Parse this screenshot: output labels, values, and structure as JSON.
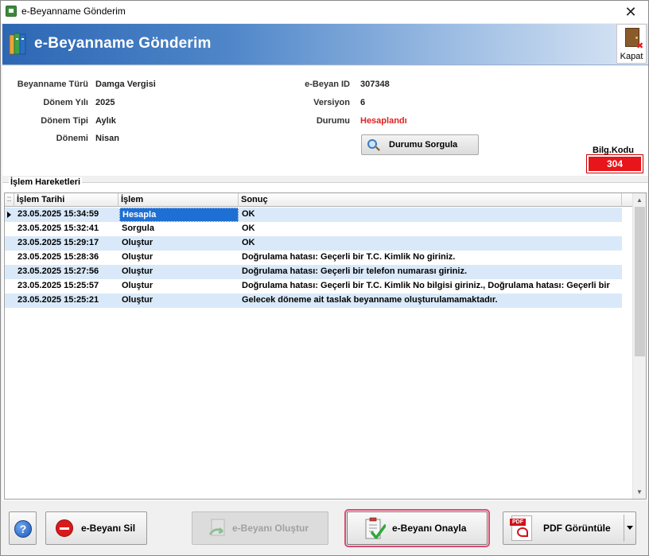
{
  "window": {
    "title": "e-Beyanname Gönderim",
    "close_glyph": "✕"
  },
  "banner": {
    "title": "e-Beyanname Gönderim",
    "icon": "books-icon",
    "close_label": "Kapat",
    "close_icon": "door-exit-icon"
  },
  "info": {
    "left": [
      {
        "label": "Beyanname Türü",
        "value": "Damga Vergisi"
      },
      {
        "label": "Dönem Yılı",
        "value": "2025"
      },
      {
        "label": "Dönem Tipi",
        "value": "Aylık"
      },
      {
        "label": "Dönemi",
        "value": "Nisan"
      }
    ],
    "right": [
      {
        "label": "e-Beyan ID",
        "value": "307348"
      },
      {
        "label": "Versiyon",
        "value": "6"
      },
      {
        "label": "Durumu",
        "value": "Hesaplandı",
        "value_color": "#e02020"
      }
    ],
    "query_button": "Durumu Sorgula",
    "bilg_kodu_label": "Bilg.Kodu",
    "bilg_kodu_value": "304",
    "bilg_kodu_color": "#e8151b"
  },
  "history": {
    "group_title": "İşlem Hareketleri",
    "indicator_header": "::",
    "columns": [
      "İşlem Tarihi",
      "İşlem",
      "Sonuç"
    ],
    "rows": [
      {
        "date": "23.05.2025 15:34:59",
        "action": "Hesapla",
        "result": "OK"
      },
      {
        "date": "23.05.2025 15:32:41",
        "action": "Sorgula",
        "result": "OK"
      },
      {
        "date": "23.05.2025 15:29:17",
        "action": "Oluştur",
        "result": "OK"
      },
      {
        "date": "23.05.2025 15:28:36",
        "action": "Oluştur",
        "result": "Doğrulama hatası: Geçerli bir T.C. Kimlik No giriniz."
      },
      {
        "date": "23.05.2025 15:27:56",
        "action": "Oluştur",
        "result": "Doğrulama hatası: Geçerli bir telefon numarası giriniz."
      },
      {
        "date": "23.05.2025 15:25:57",
        "action": "Oluştur",
        "result": "Doğrulama hatası: Geçerli bir T.C. Kimlik No bilgisi giriniz., Doğrulama hatası: Geçerli bir"
      },
      {
        "date": "23.05.2025 15:25:21",
        "action": "Oluştur",
        "result": "Gelecek döneme ait taslak beyanname oluşturulamamaktadır."
      }
    ],
    "alt_row_color": "#d9e9f9",
    "selection_color": "#1e6fd4"
  },
  "footer": {
    "help_glyph": "?",
    "delete_button": "e-Beyanı Sil",
    "create_button": "e-Beyanı Oluştur",
    "approve_button": "e-Beyanı Onayla",
    "pdf_button": "PDF Görüntüle",
    "pdf_tag": "PDF",
    "focus_color": "#d94b72"
  }
}
